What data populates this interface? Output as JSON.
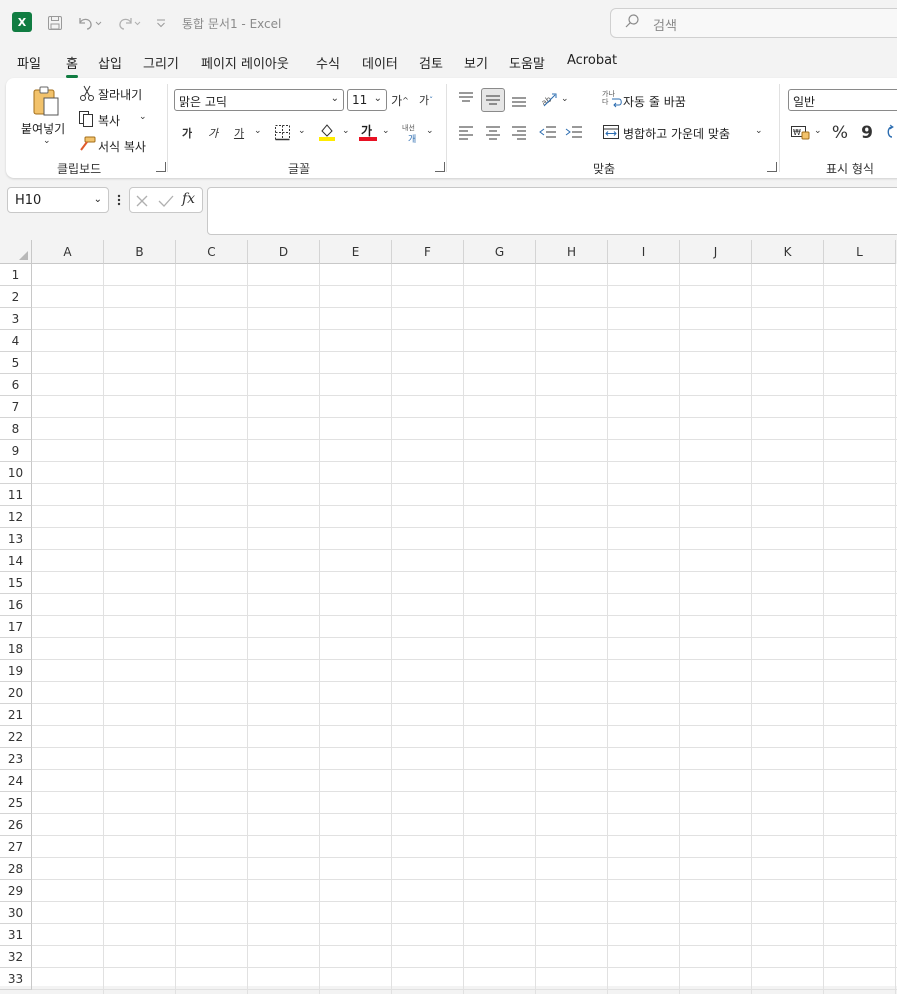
{
  "titlebar": {
    "app_logo": "X",
    "doc_title": "통합 문서1  -  Excel",
    "search_placeholder": "검색"
  },
  "menu": {
    "tabs": [
      "파일",
      "홈",
      "삽입",
      "그리기",
      "페이지 레이아웃",
      "수식",
      "데이터",
      "검토",
      "보기",
      "도움말",
      "Acrobat"
    ],
    "active": "홈"
  },
  "ribbon": {
    "clipboard": {
      "paste_label": "붙여넣기",
      "cut_label": "잘라내기",
      "copy_label": "복사",
      "format_painter_label": "서식 복사",
      "group_label": "클립보드"
    },
    "font": {
      "font_name": "맑은 고딕",
      "font_size": "11",
      "grow_label": "가",
      "shrink_label": "가",
      "bold_label": "가",
      "italic_label": "가",
      "underline_label": "가",
      "font_color_label": "가",
      "phonetic_label": "내선",
      "group_label": "글꼴"
    },
    "alignment": {
      "wrap_text_label": "자동 줄 바꿈",
      "merge_center_label": "병합하고 가운데 맞춤",
      "wrap_icon_text": "가나다",
      "group_label": "맞춤"
    },
    "number": {
      "format_value": "일반",
      "percent_label": "%",
      "comma_label": "9",
      "group_label": "표시 형식"
    }
  },
  "formula_bar": {
    "name_box": "H10",
    "fx_label": "fx",
    "formula": ""
  },
  "sheet": {
    "columns": [
      "A",
      "B",
      "C",
      "D",
      "E",
      "F",
      "G",
      "H",
      "I",
      "J",
      "K",
      "L"
    ],
    "rows": [
      "1",
      "2",
      "3",
      "4",
      "5",
      "6",
      "7",
      "8",
      "9",
      "10",
      "11",
      "12",
      "13",
      "14",
      "15",
      "16",
      "17",
      "18",
      "19",
      "20",
      "21",
      "22",
      "23",
      "24",
      "25",
      "26",
      "27",
      "28",
      "29",
      "30",
      "31",
      "32",
      "33"
    ]
  },
  "colors": {
    "accent": "#107c41",
    "fill_color_bar": "#ffeb00",
    "font_color_bar": "#e81123"
  }
}
